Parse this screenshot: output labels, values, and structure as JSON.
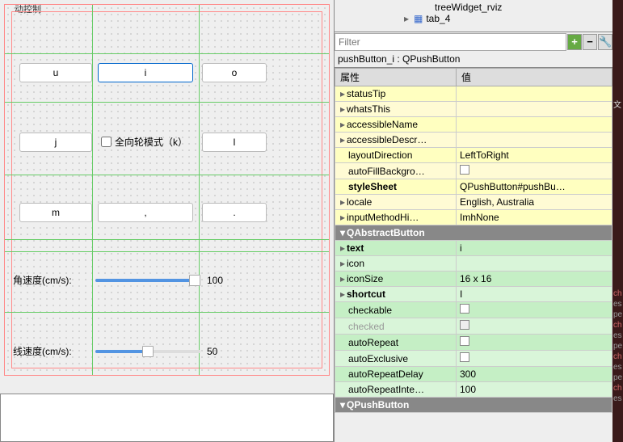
{
  "designer": {
    "title_partial": "动控制",
    "buttons": {
      "u": "u",
      "i": "i",
      "o": "o",
      "j": "j",
      "l": "l",
      "m": "m",
      "comma": ",",
      "period": "."
    },
    "checkbox_k": "全向轮模式（k）",
    "sliders": {
      "angular": {
        "label": "角速度(cm/s):",
        "value": "100"
      },
      "linear": {
        "label": "线速度(cm/s):",
        "value": "50"
      }
    }
  },
  "tree": {
    "item1": "treeWidget_rviz",
    "item2": "tab_4"
  },
  "filter": {
    "placeholder": "Filter"
  },
  "object_label": "pushButton_i : QPushButton",
  "headers": {
    "property": "属性",
    "value": "值"
  },
  "props": {
    "statusTip": {
      "name": "statusTip",
      "value": ""
    },
    "whatsThis": {
      "name": "whatsThis",
      "value": ""
    },
    "accessibleName": {
      "name": "accessibleName",
      "value": ""
    },
    "accessibleDescription": {
      "name": "accessibleDescr…",
      "value": ""
    },
    "layoutDirection": {
      "name": "layoutDirection",
      "value": "LeftToRight"
    },
    "autoFillBackground": {
      "name": "autoFillBackgro…",
      "value": ""
    },
    "styleSheet": {
      "name": "styleSheet",
      "value": "QPushButton#pushBu…"
    },
    "locale": {
      "name": "locale",
      "value": "English, Australia"
    },
    "inputMethodHints": {
      "name": "inputMethodHi…",
      "value": "ImhNone"
    },
    "qabstractbutton": "QAbstractButton",
    "text": {
      "name": "text",
      "value": "i"
    },
    "icon": {
      "name": "icon",
      "value": ""
    },
    "iconSize": {
      "name": "iconSize",
      "value": "16 x 16"
    },
    "shortcut": {
      "name": "shortcut",
      "value": "I"
    },
    "checkable": {
      "name": "checkable",
      "value": ""
    },
    "checked": {
      "name": "checked",
      "value": ""
    },
    "autoRepeat": {
      "name": "autoRepeat",
      "value": ""
    },
    "autoExclusive": {
      "name": "autoExclusive",
      "value": ""
    },
    "autoRepeatDelay": {
      "name": "autoRepeatDelay",
      "value": "300"
    },
    "autoRepeatInterval": {
      "name": "autoRepeatInte…",
      "value": "100"
    },
    "qpushbutton": "QPushButton"
  },
  "far": {
    "t1": "文",
    "ch": "ch",
    "es": "es",
    "pe": "pe"
  }
}
